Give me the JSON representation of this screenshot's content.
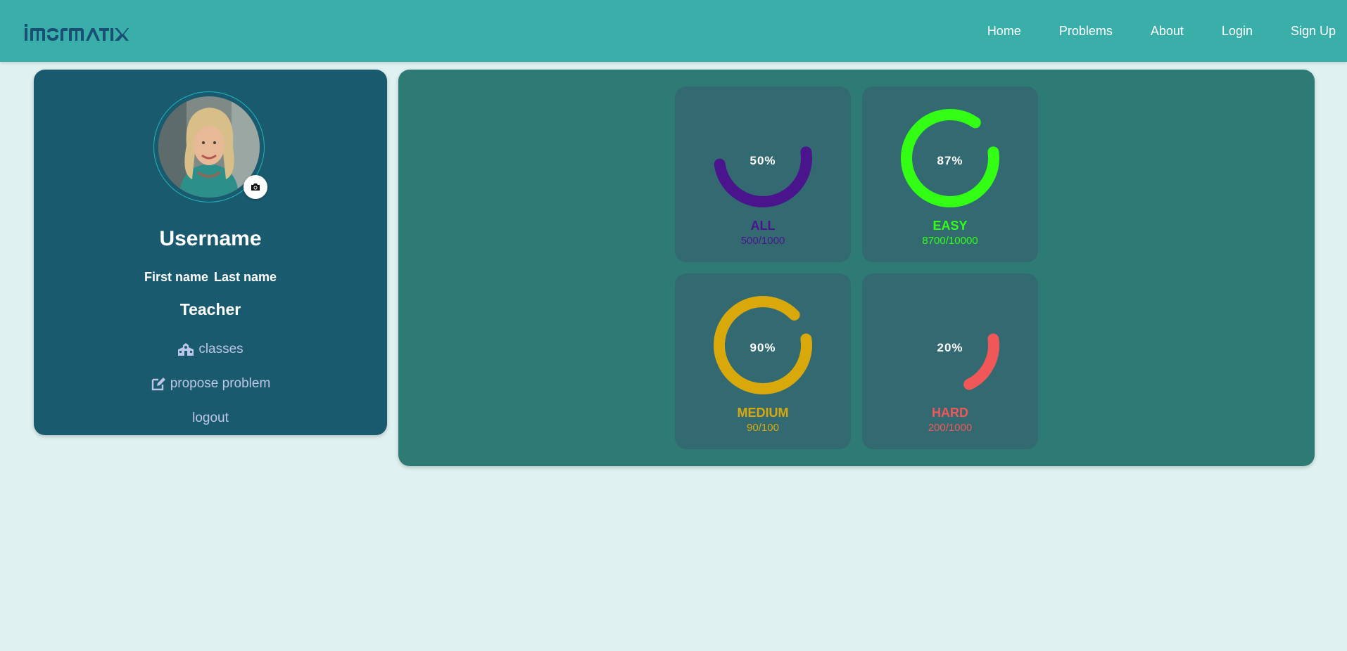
{
  "brand": {
    "logo_text": "imformatix"
  },
  "nav": [
    {
      "label": "Home"
    },
    {
      "label": "Problems"
    },
    {
      "label": "About"
    },
    {
      "label": "Login"
    },
    {
      "label": "Sign Up"
    }
  ],
  "profile": {
    "username": "Username",
    "first_name": "First name",
    "last_name": "Last name",
    "role": "Teacher",
    "links": [
      {
        "label": "classes",
        "icon": "school-icon"
      },
      {
        "label": "propose problem",
        "icon": "edit-icon"
      },
      {
        "label": "logout",
        "icon": ""
      }
    ]
  },
  "stats": [
    {
      "label": "ALL",
      "percent_text": "50%",
      "fraction": "500/1000",
      "percent": 50,
      "color": "#4a148c"
    },
    {
      "label": "EASY",
      "percent_text": "87%",
      "fraction": "8700/10000",
      "percent": 87,
      "color": "#33ff14"
    },
    {
      "label": "MEDIUM",
      "percent_text": "90%",
      "fraction": "90/100",
      "percent": 90,
      "color": "#d9a80b"
    },
    {
      "label": "HARD",
      "percent_text": "20%",
      "fraction": "200/1000",
      "percent": 20,
      "color": "#f05759"
    }
  ],
  "colors": {
    "navbar": "#3aafaa",
    "background": "#dff1f0",
    "profile_card": "#1a5a6e",
    "stats_panel": "#2e7b76",
    "stat_card": "#336a72",
    "link": "#bcc6e8"
  }
}
